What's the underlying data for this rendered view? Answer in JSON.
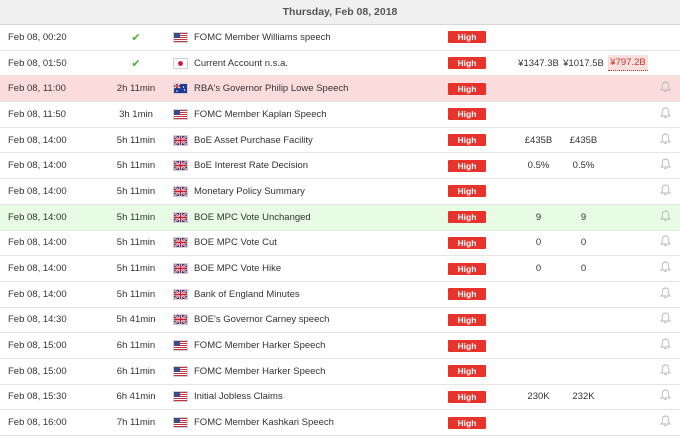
{
  "header": {
    "date": "Thursday, Feb 08, 2018"
  },
  "colors": {
    "high_badge": "#e8332c",
    "check": "#4cae3b",
    "highlight_red": "#fbdcdc",
    "highlight_green": "#e8fbe4"
  },
  "rows": [
    {
      "time": "Feb 08, 00:20",
      "left": "",
      "status": "done",
      "flag": "us-flag-icon",
      "event": "FOMC Member Williams speech",
      "importance": "High",
      "actual": "",
      "forecast": "",
      "previous": "",
      "previous_revised": false,
      "bell": false,
      "highlight": ""
    },
    {
      "time": "Feb 08, 01:50",
      "left": "",
      "status": "done",
      "flag": "jp-flag-icon",
      "event": "Current Account n.s.a.",
      "importance": "High",
      "actual": "¥1347.3B",
      "forecast": "¥1017.5B",
      "previous": "¥797.2B",
      "previous_revised": true,
      "bell": false,
      "highlight": ""
    },
    {
      "time": "Feb 08, 11:00",
      "left": "2h 11min",
      "status": "pending",
      "flag": "au-flag-icon",
      "event": "RBA's Governor Philip Lowe Speech",
      "importance": "High",
      "actual": "",
      "forecast": "",
      "previous": "",
      "previous_revised": false,
      "bell": true,
      "highlight": "red"
    },
    {
      "time": "Feb 08, 11:50",
      "left": "3h 1min",
      "status": "pending",
      "flag": "us-flag-icon",
      "event": "FOMC Member Kaplan Speech",
      "importance": "High",
      "actual": "",
      "forecast": "",
      "previous": "",
      "previous_revised": false,
      "bell": true,
      "highlight": ""
    },
    {
      "time": "Feb 08, 14:00",
      "left": "5h 11min",
      "status": "pending",
      "flag": "uk-flag-icon",
      "event": "BoE Asset Purchase Facility",
      "importance": "High",
      "actual": "£435B",
      "forecast": "£435B",
      "previous": "",
      "previous_revised": false,
      "bell": true,
      "highlight": ""
    },
    {
      "time": "Feb 08, 14:00",
      "left": "5h 11min",
      "status": "pending",
      "flag": "uk-flag-icon",
      "event": "BoE Interest Rate Decision",
      "importance": "High",
      "actual": "0.5%",
      "forecast": "0.5%",
      "previous": "",
      "previous_revised": false,
      "bell": true,
      "highlight": ""
    },
    {
      "time": "Feb 08, 14:00",
      "left": "5h 11min",
      "status": "pending",
      "flag": "uk-flag-icon",
      "event": "Monetary Policy Summary",
      "importance": "High",
      "actual": "",
      "forecast": "",
      "previous": "",
      "previous_revised": false,
      "bell": true,
      "highlight": ""
    },
    {
      "time": "Feb 08, 14:00",
      "left": "5h 11min",
      "status": "pending",
      "flag": "uk-flag-icon",
      "event": "BOE MPC Vote Unchanged",
      "importance": "High",
      "actual": "9",
      "forecast": "9",
      "previous": "",
      "previous_revised": false,
      "bell": true,
      "highlight": "green"
    },
    {
      "time": "Feb 08, 14:00",
      "left": "5h 11min",
      "status": "pending",
      "flag": "uk-flag-icon",
      "event": "BOE MPC Vote Cut",
      "importance": "High",
      "actual": "0",
      "forecast": "0",
      "previous": "",
      "previous_revised": false,
      "bell": true,
      "highlight": ""
    },
    {
      "time": "Feb 08, 14:00",
      "left": "5h 11min",
      "status": "pending",
      "flag": "uk-flag-icon",
      "event": "BOE MPC Vote Hike",
      "importance": "High",
      "actual": "0",
      "forecast": "0",
      "previous": "",
      "previous_revised": false,
      "bell": true,
      "highlight": ""
    },
    {
      "time": "Feb 08, 14:00",
      "left": "5h 11min",
      "status": "pending",
      "flag": "uk-flag-icon",
      "event": "Bank of England Minutes",
      "importance": "High",
      "actual": "",
      "forecast": "",
      "previous": "",
      "previous_revised": false,
      "bell": true,
      "highlight": ""
    },
    {
      "time": "Feb 08, 14:30",
      "left": "5h 41min",
      "status": "pending",
      "flag": "uk-flag-icon",
      "event": "BOE's Governor Carney speech",
      "importance": "High",
      "actual": "",
      "forecast": "",
      "previous": "",
      "previous_revised": false,
      "bell": true,
      "highlight": ""
    },
    {
      "time": "Feb 08, 15:00",
      "left": "6h 11min",
      "status": "pending",
      "flag": "us-flag-icon",
      "event": "FOMC Member Harker Speech",
      "importance": "High",
      "actual": "",
      "forecast": "",
      "previous": "",
      "previous_revised": false,
      "bell": true,
      "highlight": ""
    },
    {
      "time": "Feb 08, 15:00",
      "left": "6h 11min",
      "status": "pending",
      "flag": "us-flag-icon",
      "event": "FOMC Member Harker Speech",
      "importance": "High",
      "actual": "",
      "forecast": "",
      "previous": "",
      "previous_revised": false,
      "bell": true,
      "highlight": ""
    },
    {
      "time": "Feb 08, 15:30",
      "left": "6h 41min",
      "status": "pending",
      "flag": "us-flag-icon",
      "event": "Initial Jobless Claims",
      "importance": "High",
      "actual": "230K",
      "forecast": "232K",
      "previous": "",
      "previous_revised": false,
      "bell": true,
      "highlight": ""
    },
    {
      "time": "Feb 08, 16:00",
      "left": "7h 11min",
      "status": "pending",
      "flag": "us-flag-icon",
      "event": "FOMC Member Kashkari Speech",
      "importance": "High",
      "actual": "",
      "forecast": "",
      "previous": "",
      "previous_revised": false,
      "bell": true,
      "highlight": ""
    }
  ]
}
